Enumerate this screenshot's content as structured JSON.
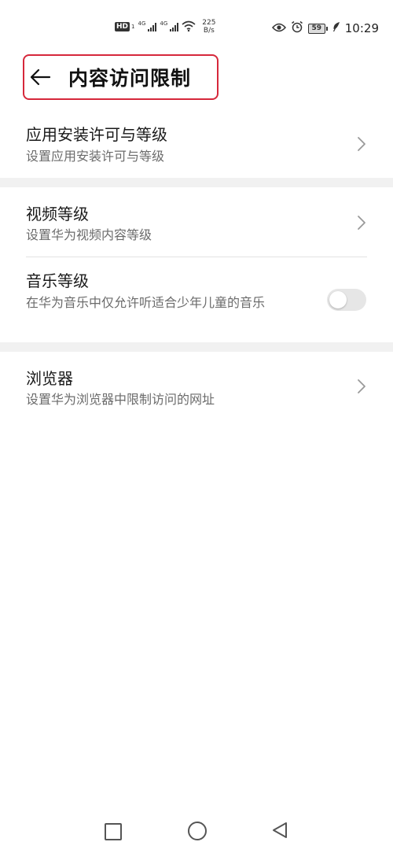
{
  "status_bar": {
    "hd": "HD",
    "sim": "1",
    "net1": "4G",
    "net2": "4G",
    "speed_value": "225",
    "speed_unit": "B/s",
    "battery": "59",
    "time": "10:29"
  },
  "header": {
    "title": "内容访问限制"
  },
  "items": [
    {
      "title": "应用安装许可与等级",
      "subtitle": "设置应用安装许可与等级"
    },
    {
      "title": "视频等级",
      "subtitle": "设置华为视频内容等级"
    },
    {
      "title": "音乐等级",
      "subtitle": "在华为音乐中仅允许听适合少年儿童的音乐",
      "toggle_on": false
    },
    {
      "title": "浏览器",
      "subtitle": "设置华为浏览器中限制访问的网址"
    }
  ],
  "colors": {
    "header_outline": "#d6283b",
    "section_gap": "#f1f1f1",
    "subtitle": "#6b6b6b"
  }
}
